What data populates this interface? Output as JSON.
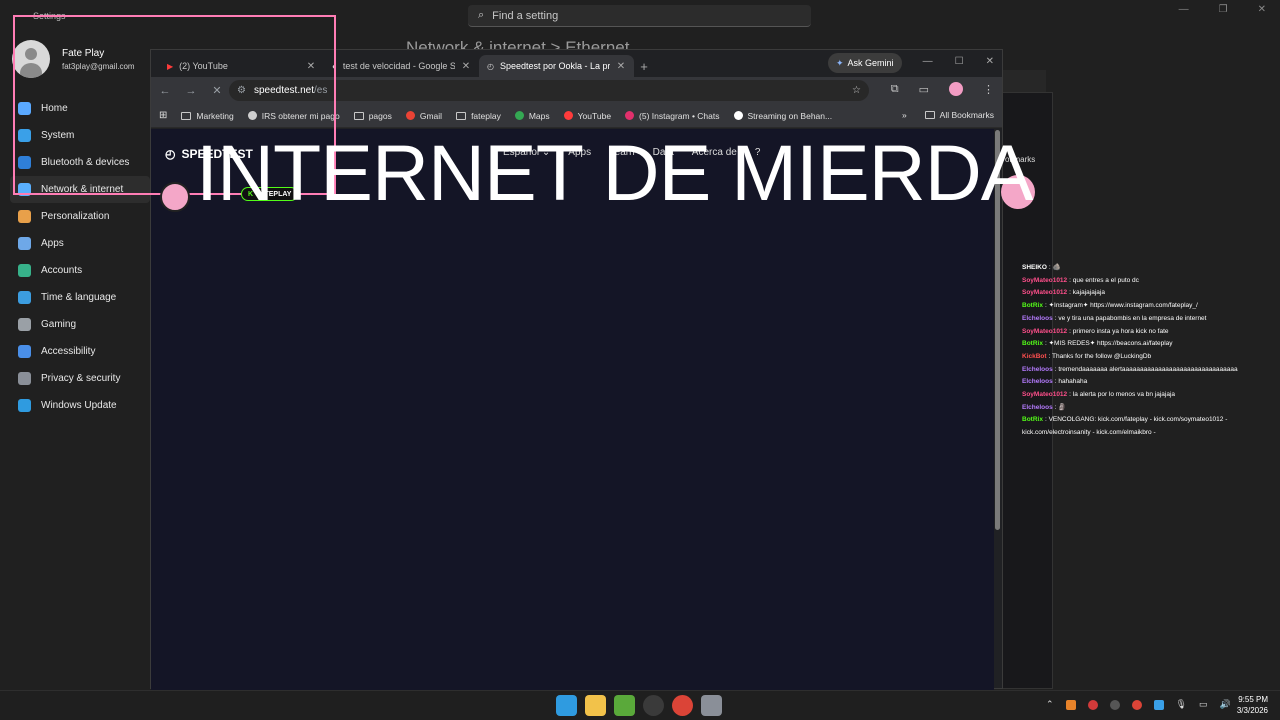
{
  "settings": {
    "window_title": "Settings",
    "search_placeholder": "Find a setting",
    "profile": {
      "name": "Fate Play",
      "email": "fat3play@gmail.com"
    },
    "heading": "Network & internet  >  Ethernet",
    "nav": [
      {
        "label": "Home",
        "color": "#5aa9ff"
      },
      {
        "label": "System",
        "color": "#3aa0e8"
      },
      {
        "label": "Bluetooth & devices",
        "color": "#2f7fd8"
      },
      {
        "label": "Network & internet",
        "color": "#5ab0ff"
      },
      {
        "label": "Personalization",
        "color": "#e8a04a"
      },
      {
        "label": "Apps",
        "color": "#6ea8e8"
      },
      {
        "label": "Accounts",
        "color": "#37b28a"
      },
      {
        "label": "Time & language",
        "color": "#3c9de0"
      },
      {
        "label": "Gaming",
        "color": "#9aa0a6"
      },
      {
        "label": "Accessibility",
        "color": "#4a8fe8"
      },
      {
        "label": "Privacy & security",
        "color": "#8a8f98"
      },
      {
        "label": "Windows Update",
        "color": "#2f9be0"
      }
    ]
  },
  "browser": {
    "tabs": [
      {
        "label": "(2) YouTube",
        "icon": "youtube-icon",
        "active": false
      },
      {
        "label": "test de velocidad - Google Sear",
        "icon": "google-icon",
        "active": false
      },
      {
        "label": "Speedtest por Ookla - La prueb",
        "icon": "speedtest-icon",
        "active": true
      }
    ],
    "ask_gemini": "Ask Gemini",
    "url_host": "speedtest.net",
    "url_path": "/es",
    "bookmarks": [
      {
        "label": "Marketing",
        "icon": "folder-icon"
      },
      {
        "label": "IRS obtener mi pago",
        "icon": "irs-icon"
      },
      {
        "label": "pagos",
        "icon": "folder-icon"
      },
      {
        "label": "Gmail",
        "icon": "gmail-icon"
      },
      {
        "label": "fateplay",
        "icon": "folder-icon"
      },
      {
        "label": "Maps",
        "icon": "maps-icon"
      },
      {
        "label": "YouTube",
        "icon": "youtube-icon"
      },
      {
        "label": "(5) Instagram • Chats",
        "icon": "instagram-icon"
      },
      {
        "label": "Streaming on Behan...",
        "icon": "behance-icon"
      }
    ],
    "all_bookmarks": "All Bookmarks",
    "speedtest": {
      "logo_text": "SPEEDTEST",
      "nav": [
        "Español ⌄",
        "Apps",
        "Learn",
        "Data",
        "Acerca de",
        "?"
      ]
    }
  },
  "browser2": {
    "bookmarks_label": "okmarks"
  },
  "overlay": {
    "title": "INTERNET DE MIERDA",
    "badge": "FATEPLAY"
  },
  "chat": [
    {
      "user": "SHEIKO",
      "user_color": "#ffffff",
      "text": ": 🪨"
    },
    {
      "user": "SoyMateo1012",
      "user_color": "#ff4f8b",
      "text": ": que entres a el puto dc"
    },
    {
      "user": "SoyMateo1012",
      "user_color": "#ff4f8b",
      "text": ": kajajajajaja"
    },
    {
      "user": "BotRix",
      "user_color": "#53fc18",
      "text": ": ✦Instagram✦ https://www.instagram.com/fateplay_/"
    },
    {
      "user": "Elcheloos",
      "user_color": "#b57bff",
      "text": ": ve y tira una papabombis en la empresa de internet"
    },
    {
      "user": "SoyMateo1012",
      "user_color": "#ff4f8b",
      "text": ": primero insta ya hora kick no fate"
    },
    {
      "user": "BotRix",
      "user_color": "#53fc18",
      "text": ": ✦MIS REDES✦ https://beacons.ai/fateplay"
    },
    {
      "user": "KickBot",
      "user_color": "#ff4f4f",
      "text": ": Thanks for the follow @LuckingDb"
    },
    {
      "user": "Elcheloos",
      "user_color": "#b57bff",
      "text": ": tremendaaaaaaa alertaaaaaaaaaaaaaaaaaaaaaaaaaaaaaaaa"
    },
    {
      "user": "Elcheloos",
      "user_color": "#b57bff",
      "text": ": hahahaha"
    },
    {
      "user": "SoyMateo1012",
      "user_color": "#ff4f8b",
      "text": ": la alerta por lo menos va bn jajajaja"
    },
    {
      "user": "Elcheloos",
      "user_color": "#b57bff",
      "text": ": 🗿"
    },
    {
      "user": "BotRix",
      "user_color": "#53fc18",
      "text": ": VENCOLGANG: kick.com/fateplay - kick.com/soymateo1012 - kick.com/electroinsanity - kick.com/elmaikbro -"
    }
  ],
  "taskbar": {
    "apps": [
      {
        "name": "start-icon",
        "color": "#2f9be0"
      },
      {
        "name": "file-explorer-icon",
        "color": "#f2c24a"
      },
      {
        "name": "minecraft-icon",
        "color": "#5aa93a"
      },
      {
        "name": "obs-icon",
        "color": "#3a3a3a"
      },
      {
        "name": "chrome-icon",
        "color": "#db4437"
      },
      {
        "name": "settings-icon",
        "color": "#8a8f98"
      }
    ],
    "time": "9:55 PM",
    "date": "3/3/2026"
  }
}
